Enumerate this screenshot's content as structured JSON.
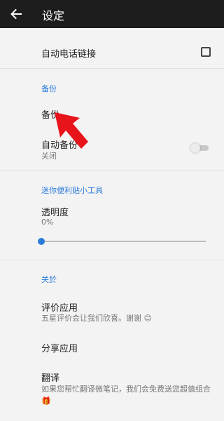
{
  "header": {
    "title": "设定",
    "back_icon": "arrow-left-icon"
  },
  "rows": {
    "auto_phone_link": {
      "label": "自动电话链接",
      "checked": false
    },
    "backup_section": "备份",
    "backup": {
      "label": "备份"
    },
    "auto_backup": {
      "label": "自动备份",
      "status": "关闭",
      "enabled": false
    },
    "widget_section": "迷你便利贴小工具",
    "transparency": {
      "label": "透明度",
      "value_text": "0%",
      "value": 0
    },
    "about_section": "关於",
    "rate": {
      "label": "评价应用",
      "desc": "五星评价会让我们欣喜。谢谢",
      "emoji": "😊"
    },
    "share": {
      "label": "分享应用"
    },
    "translate": {
      "label": "翻译",
      "desc": "如果您帮忙翻译微笔记，我们会免费送您超值组合",
      "emoji": "🎁"
    }
  },
  "colors": {
    "accent": "#2b7bd9",
    "topbar": "#1d1d1d",
    "arrow": "#e8141b"
  }
}
